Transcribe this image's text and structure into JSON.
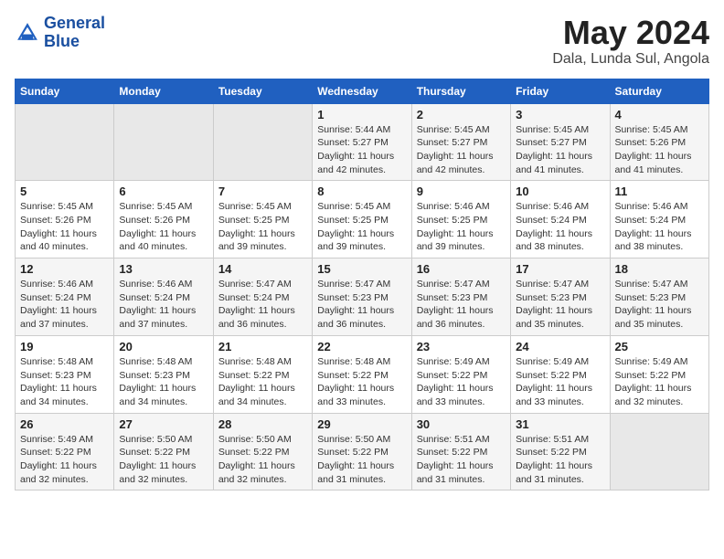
{
  "logo": {
    "line1": "General",
    "line2": "Blue"
  },
  "title": "May 2024",
  "subtitle": "Dala, Lunda Sul, Angola",
  "weekdays": [
    "Sunday",
    "Monday",
    "Tuesday",
    "Wednesday",
    "Thursday",
    "Friday",
    "Saturday"
  ],
  "weeks": [
    [
      {
        "day": "",
        "info": ""
      },
      {
        "day": "",
        "info": ""
      },
      {
        "day": "",
        "info": ""
      },
      {
        "day": "1",
        "info": "Sunrise: 5:44 AM\nSunset: 5:27 PM\nDaylight: 11 hours\nand 42 minutes."
      },
      {
        "day": "2",
        "info": "Sunrise: 5:45 AM\nSunset: 5:27 PM\nDaylight: 11 hours\nand 42 minutes."
      },
      {
        "day": "3",
        "info": "Sunrise: 5:45 AM\nSunset: 5:27 PM\nDaylight: 11 hours\nand 41 minutes."
      },
      {
        "day": "4",
        "info": "Sunrise: 5:45 AM\nSunset: 5:26 PM\nDaylight: 11 hours\nand 41 minutes."
      }
    ],
    [
      {
        "day": "5",
        "info": "Sunrise: 5:45 AM\nSunset: 5:26 PM\nDaylight: 11 hours\nand 40 minutes."
      },
      {
        "day": "6",
        "info": "Sunrise: 5:45 AM\nSunset: 5:26 PM\nDaylight: 11 hours\nand 40 minutes."
      },
      {
        "day": "7",
        "info": "Sunrise: 5:45 AM\nSunset: 5:25 PM\nDaylight: 11 hours\nand 39 minutes."
      },
      {
        "day": "8",
        "info": "Sunrise: 5:45 AM\nSunset: 5:25 PM\nDaylight: 11 hours\nand 39 minutes."
      },
      {
        "day": "9",
        "info": "Sunrise: 5:46 AM\nSunset: 5:25 PM\nDaylight: 11 hours\nand 39 minutes."
      },
      {
        "day": "10",
        "info": "Sunrise: 5:46 AM\nSunset: 5:24 PM\nDaylight: 11 hours\nand 38 minutes."
      },
      {
        "day": "11",
        "info": "Sunrise: 5:46 AM\nSunset: 5:24 PM\nDaylight: 11 hours\nand 38 minutes."
      }
    ],
    [
      {
        "day": "12",
        "info": "Sunrise: 5:46 AM\nSunset: 5:24 PM\nDaylight: 11 hours\nand 37 minutes."
      },
      {
        "day": "13",
        "info": "Sunrise: 5:46 AM\nSunset: 5:24 PM\nDaylight: 11 hours\nand 37 minutes."
      },
      {
        "day": "14",
        "info": "Sunrise: 5:47 AM\nSunset: 5:24 PM\nDaylight: 11 hours\nand 36 minutes."
      },
      {
        "day": "15",
        "info": "Sunrise: 5:47 AM\nSunset: 5:23 PM\nDaylight: 11 hours\nand 36 minutes."
      },
      {
        "day": "16",
        "info": "Sunrise: 5:47 AM\nSunset: 5:23 PM\nDaylight: 11 hours\nand 36 minutes."
      },
      {
        "day": "17",
        "info": "Sunrise: 5:47 AM\nSunset: 5:23 PM\nDaylight: 11 hours\nand 35 minutes."
      },
      {
        "day": "18",
        "info": "Sunrise: 5:47 AM\nSunset: 5:23 PM\nDaylight: 11 hours\nand 35 minutes."
      }
    ],
    [
      {
        "day": "19",
        "info": "Sunrise: 5:48 AM\nSunset: 5:23 PM\nDaylight: 11 hours\nand 34 minutes."
      },
      {
        "day": "20",
        "info": "Sunrise: 5:48 AM\nSunset: 5:23 PM\nDaylight: 11 hours\nand 34 minutes."
      },
      {
        "day": "21",
        "info": "Sunrise: 5:48 AM\nSunset: 5:22 PM\nDaylight: 11 hours\nand 34 minutes."
      },
      {
        "day": "22",
        "info": "Sunrise: 5:48 AM\nSunset: 5:22 PM\nDaylight: 11 hours\nand 33 minutes."
      },
      {
        "day": "23",
        "info": "Sunrise: 5:49 AM\nSunset: 5:22 PM\nDaylight: 11 hours\nand 33 minutes."
      },
      {
        "day": "24",
        "info": "Sunrise: 5:49 AM\nSunset: 5:22 PM\nDaylight: 11 hours\nand 33 minutes."
      },
      {
        "day": "25",
        "info": "Sunrise: 5:49 AM\nSunset: 5:22 PM\nDaylight: 11 hours\nand 32 minutes."
      }
    ],
    [
      {
        "day": "26",
        "info": "Sunrise: 5:49 AM\nSunset: 5:22 PM\nDaylight: 11 hours\nand 32 minutes."
      },
      {
        "day": "27",
        "info": "Sunrise: 5:50 AM\nSunset: 5:22 PM\nDaylight: 11 hours\nand 32 minutes."
      },
      {
        "day": "28",
        "info": "Sunrise: 5:50 AM\nSunset: 5:22 PM\nDaylight: 11 hours\nand 32 minutes."
      },
      {
        "day": "29",
        "info": "Sunrise: 5:50 AM\nSunset: 5:22 PM\nDaylight: 11 hours\nand 31 minutes."
      },
      {
        "day": "30",
        "info": "Sunrise: 5:51 AM\nSunset: 5:22 PM\nDaylight: 11 hours\nand 31 minutes."
      },
      {
        "day": "31",
        "info": "Sunrise: 5:51 AM\nSunset: 5:22 PM\nDaylight: 11 hours\nand 31 minutes."
      },
      {
        "day": "",
        "info": ""
      }
    ]
  ]
}
